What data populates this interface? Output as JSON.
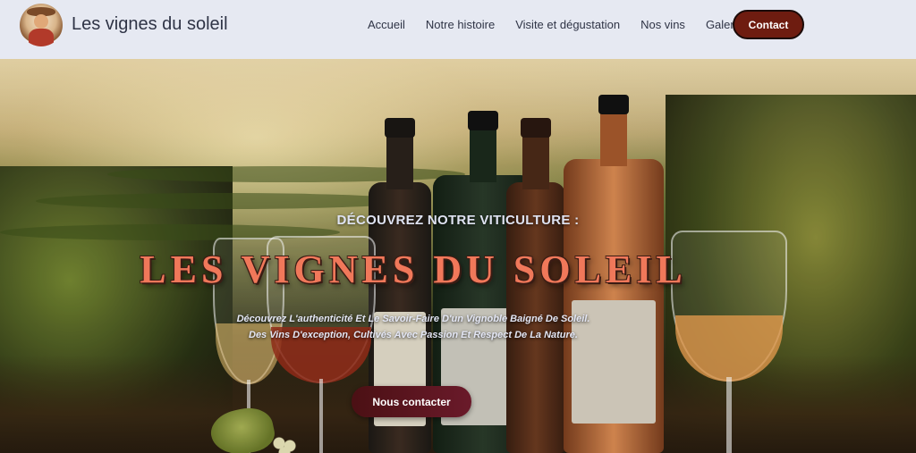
{
  "header": {
    "brand": "Les vignes du soleil",
    "nav": [
      "Accueil",
      "Notre histoire",
      "Visite et dégustation",
      "Nos vins",
      "Galerie"
    ],
    "contact_label": "Contact"
  },
  "hero": {
    "kicker": "DÉCOUVREZ NOTRE VITICULTURE :",
    "title": "LES VIGNES DU SOLEIL",
    "description": "Découvrez L'authenticité Et Le Savoir-Faire D'un Vignoble Baigné De Soleil. Des Vins D'exception, Cultivés Avec Passion Et Respect De La Nature.",
    "cta_label": "Nous contacter"
  },
  "colors": {
    "header_bg": "#e6e9f2",
    "contact_bg": "#6e1c10",
    "title": "#f0785a",
    "cta_bg": "#5a1420"
  },
  "icons": {
    "logo": "winemaker-avatar"
  }
}
